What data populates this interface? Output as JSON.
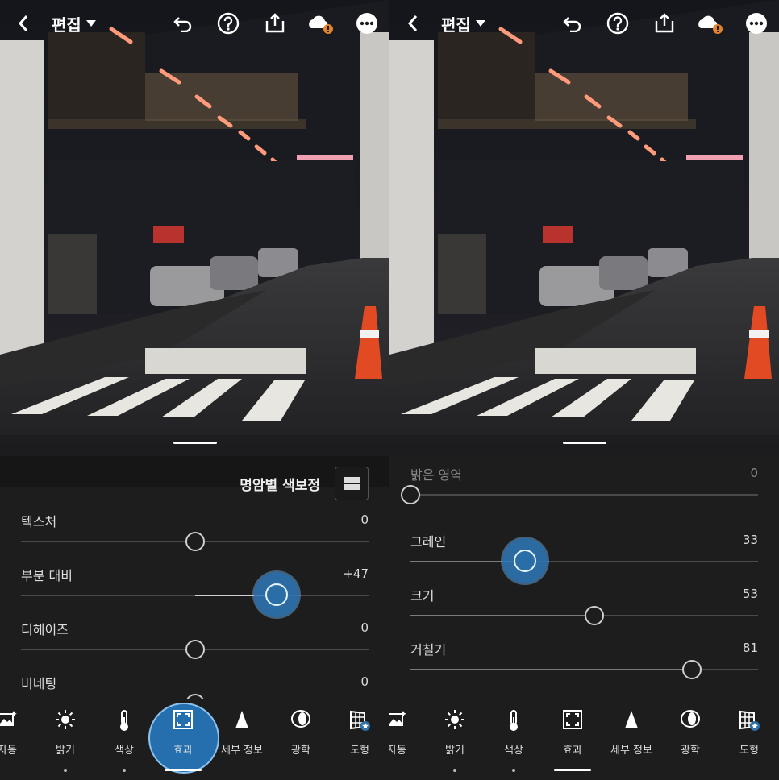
{
  "colors": {
    "panel": "#1d1d1d",
    "accent": "#256fae",
    "track": "#4a4a4a",
    "fill": "#d0d0d0",
    "warning": "#e3832b"
  },
  "left": {
    "topbar": {
      "title": "편집",
      "icons": [
        "back-chevron-icon",
        "dropdown-caret-icon",
        "undo-icon",
        "help-icon",
        "share-icon",
        "cloud-warning-icon",
        "more-icon"
      ]
    },
    "section": {
      "title": "명암별 색보정"
    },
    "sliders": [
      {
        "label": "텍스처",
        "value": "0",
        "level": 0.5,
        "active": false
      },
      {
        "label": "부분 대비",
        "value": "+47",
        "level": 0.735,
        "active": true
      },
      {
        "label": "디헤이즈",
        "value": "0",
        "level": 0.5,
        "active": false
      },
      {
        "label": "비네팅",
        "value": "0",
        "level": 0.5,
        "active": false
      }
    ],
    "tools": [
      {
        "label": "자동",
        "icon": "auto-icon"
      },
      {
        "label": "밝기",
        "icon": "sun-icon"
      },
      {
        "label": "색상",
        "icon": "thermometer-icon"
      },
      {
        "label": "효과",
        "icon": "effects-icon"
      },
      {
        "label": "세부 정보",
        "icon": "detail-icon"
      },
      {
        "label": "광학",
        "icon": "lens-icon"
      },
      {
        "label": "도형",
        "icon": "geometry-icon"
      }
    ]
  },
  "right": {
    "topbar": {
      "title": "편집"
    },
    "section": {
      "title": "밝은 영역",
      "value": "0",
      "level": 0.0
    },
    "sliders": [
      {
        "label": "그레인",
        "value": "33",
        "level": 0.33,
        "active": true
      },
      {
        "label": "크기",
        "value": "53",
        "level": 0.53,
        "active": false
      },
      {
        "label": "거칠기",
        "value": "81",
        "level": 0.81,
        "active": false
      }
    ],
    "tools": [
      {
        "label": "자동",
        "icon": "auto-icon"
      },
      {
        "label": "밝기",
        "icon": "sun-icon"
      },
      {
        "label": "색상",
        "icon": "thermometer-icon"
      },
      {
        "label": "효과",
        "icon": "effects-icon"
      },
      {
        "label": "세부 정보",
        "icon": "detail-icon"
      },
      {
        "label": "광학",
        "icon": "lens-icon"
      },
      {
        "label": "도형",
        "icon": "geometry-icon"
      }
    ]
  }
}
